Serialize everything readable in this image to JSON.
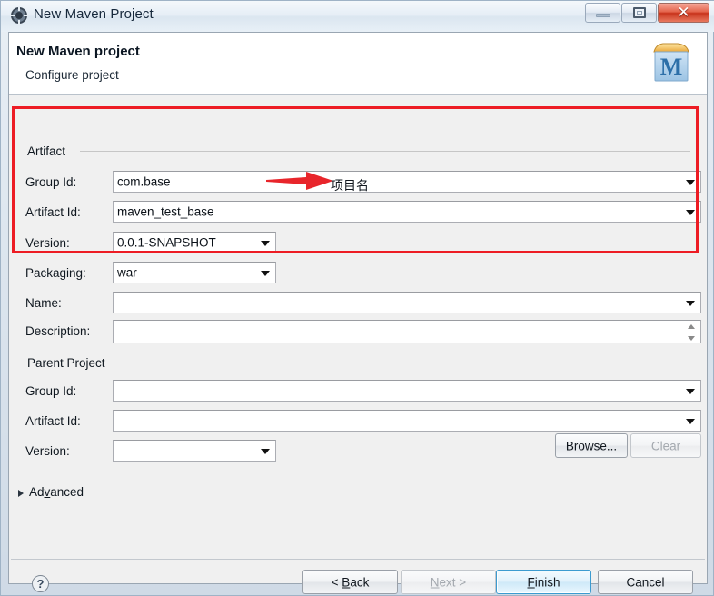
{
  "window": {
    "title": "New Maven Project",
    "icon": "eclipse-wizard-icon",
    "buttons": {
      "minimize": "minimize-icon",
      "maximize": "maximize-icon",
      "close": "✕"
    }
  },
  "header": {
    "title": "New Maven project",
    "subtitle": "Configure project",
    "logo": "maven-logo-icon",
    "logo_letter": "M"
  },
  "artifact": {
    "group_title": "Artifact",
    "fields": [
      {
        "label": "Group Id:",
        "value": "com.base",
        "widget": "combo-wide"
      },
      {
        "label": "Artifact Id:",
        "value": "maven_test_base",
        "widget": "combo-wide"
      },
      {
        "label": "Version:",
        "value": "0.0.1-SNAPSHOT",
        "widget": "combo-short"
      },
      {
        "label": "Packaging:",
        "value": "war",
        "widget": "combo-short"
      }
    ]
  },
  "details": {
    "name": {
      "label": "Name:",
      "value": ""
    },
    "description": {
      "label": "Description:",
      "value": ""
    }
  },
  "parent": {
    "group_title": "Parent Project",
    "fields": [
      {
        "label": "Group Id:",
        "value": "",
        "widget": "combo-wide"
      },
      {
        "label": "Artifact Id:",
        "value": "",
        "widget": "combo-wide"
      },
      {
        "label": "Version:",
        "value": "",
        "widget": "combo-short"
      }
    ],
    "browse_label": "Browse...",
    "clear_label": "Clear",
    "clear_disabled": true
  },
  "advanced": {
    "label_pre": "Ad",
    "label_mnemonic": "v",
    "label_post": "anced",
    "expanded": false
  },
  "footer": {
    "help": "?",
    "buttons": [
      {
        "name": "back",
        "pre": "< ",
        "mnemonic": "B",
        "post": "ack",
        "state": "enabled"
      },
      {
        "name": "next",
        "pre": "",
        "mnemonic": "N",
        "post": "ext >",
        "state": "disabled"
      },
      {
        "name": "finish",
        "pre": "",
        "mnemonic": "F",
        "post": "inish",
        "state": "default"
      },
      {
        "name": "cancel",
        "pre": "",
        "mnemonic": "",
        "post": "Cancel",
        "state": "enabled"
      }
    ]
  },
  "annotation": {
    "note_text": "项目名",
    "box_color": "#ed1c24",
    "arrow_color": "#e8252b"
  }
}
